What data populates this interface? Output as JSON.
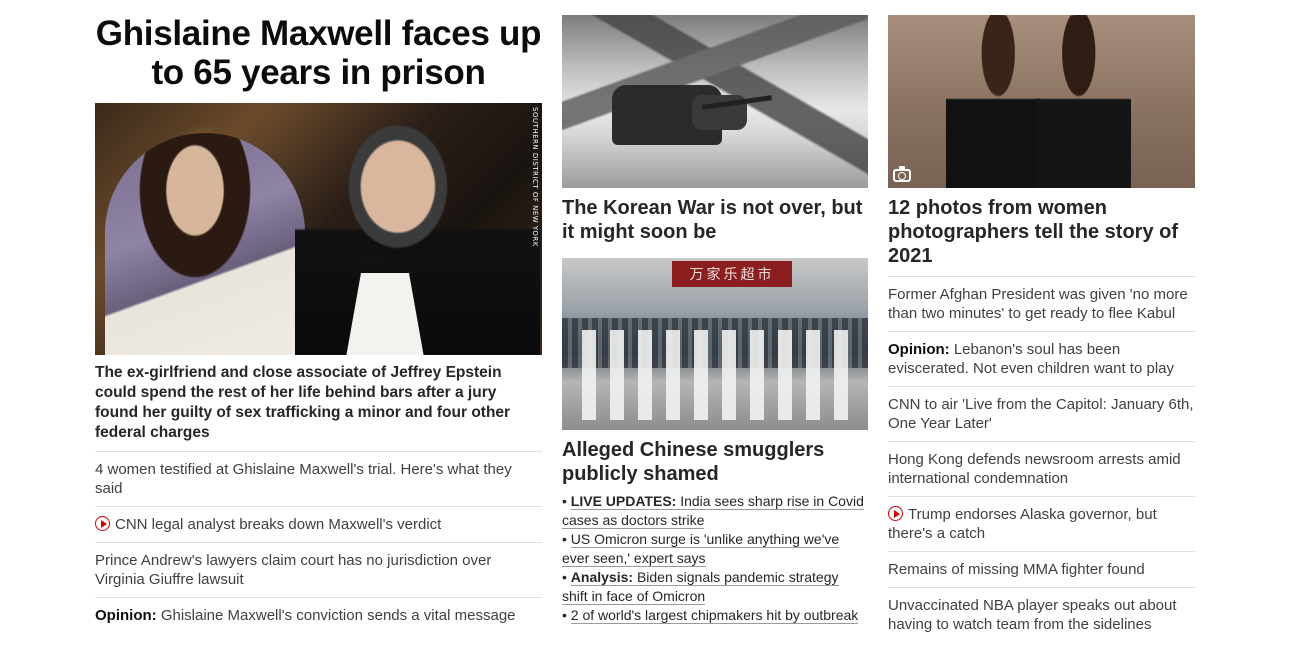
{
  "lead": {
    "title": "Ghislaine Maxwell faces up to 65 years in prison",
    "image_credit": "SOUTHERN DISTRICT OF NEW YORK",
    "description": "The ex-girlfriend and close associate of Jeffrey Epstein could spend the rest of her life behind bars after a jury found her guilty of sex trafficking a minor and four other federal charges",
    "links": [
      {
        "prefix": "",
        "text": "4 women testified at Ghislaine Maxwell's trial. Here's what they said",
        "video": false
      },
      {
        "prefix": "",
        "text": "CNN legal analyst breaks down Maxwell's verdict",
        "video": true
      },
      {
        "prefix": "",
        "text": "Prince Andrew's lawyers claim court has no jurisdiction over Virginia Giuffre lawsuit",
        "video": false
      },
      {
        "prefix": "Opinion:",
        "text": "Ghislaine Maxwell's conviction sends a vital message",
        "video": false
      }
    ]
  },
  "middle": {
    "korea_title": "The Korean War is not over, but it might soon be",
    "china_sign": "万家乐超市",
    "china_title": "Alleged Chinese smugglers publicly shamed",
    "bullets": [
      {
        "prefix": "LIVE UPDATES:",
        "text": "India sees sharp rise in Covid cases as doctors strike"
      },
      {
        "prefix": "",
        "text": "US Omicron surge is 'unlike anything we've ever seen,' expert says"
      },
      {
        "prefix": "Analysis:",
        "text": "Biden signals pandemic strategy shift in face of Omicron"
      },
      {
        "prefix": "",
        "text": "2 of world's largest chipmakers hit by outbreak"
      }
    ]
  },
  "right": {
    "photos_title": "12 photos from women photographers tell the story of 2021",
    "links": [
      {
        "prefix": "",
        "text": "Former Afghan President was given 'no more than two minutes' to get ready to flee Kabul",
        "video": false
      },
      {
        "prefix": "Opinion:",
        "text": "Lebanon's soul has been eviscerated. Not even children want to play",
        "video": false
      },
      {
        "prefix": "",
        "text": "CNN to air 'Live from the Capitol: January 6th, One Year Later'",
        "video": false
      },
      {
        "prefix": "",
        "text": "Hong Kong defends newsroom arrests amid international condemnation",
        "video": false
      },
      {
        "prefix": "",
        "text": "Trump endorses Alaska governor, but there's a catch",
        "video": true
      },
      {
        "prefix": "",
        "text": "Remains of missing MMA fighter found",
        "video": false
      },
      {
        "prefix": "",
        "text": "Unvaccinated NBA player speaks out about having to watch team from the sidelines",
        "video": false
      }
    ]
  },
  "icons": {
    "video": "play-circle-icon",
    "gallery": "camera-icon"
  },
  "colors": {
    "accent_red": "#cc0000",
    "text": "#0c0c0c",
    "divider": "#e0e0e0"
  }
}
